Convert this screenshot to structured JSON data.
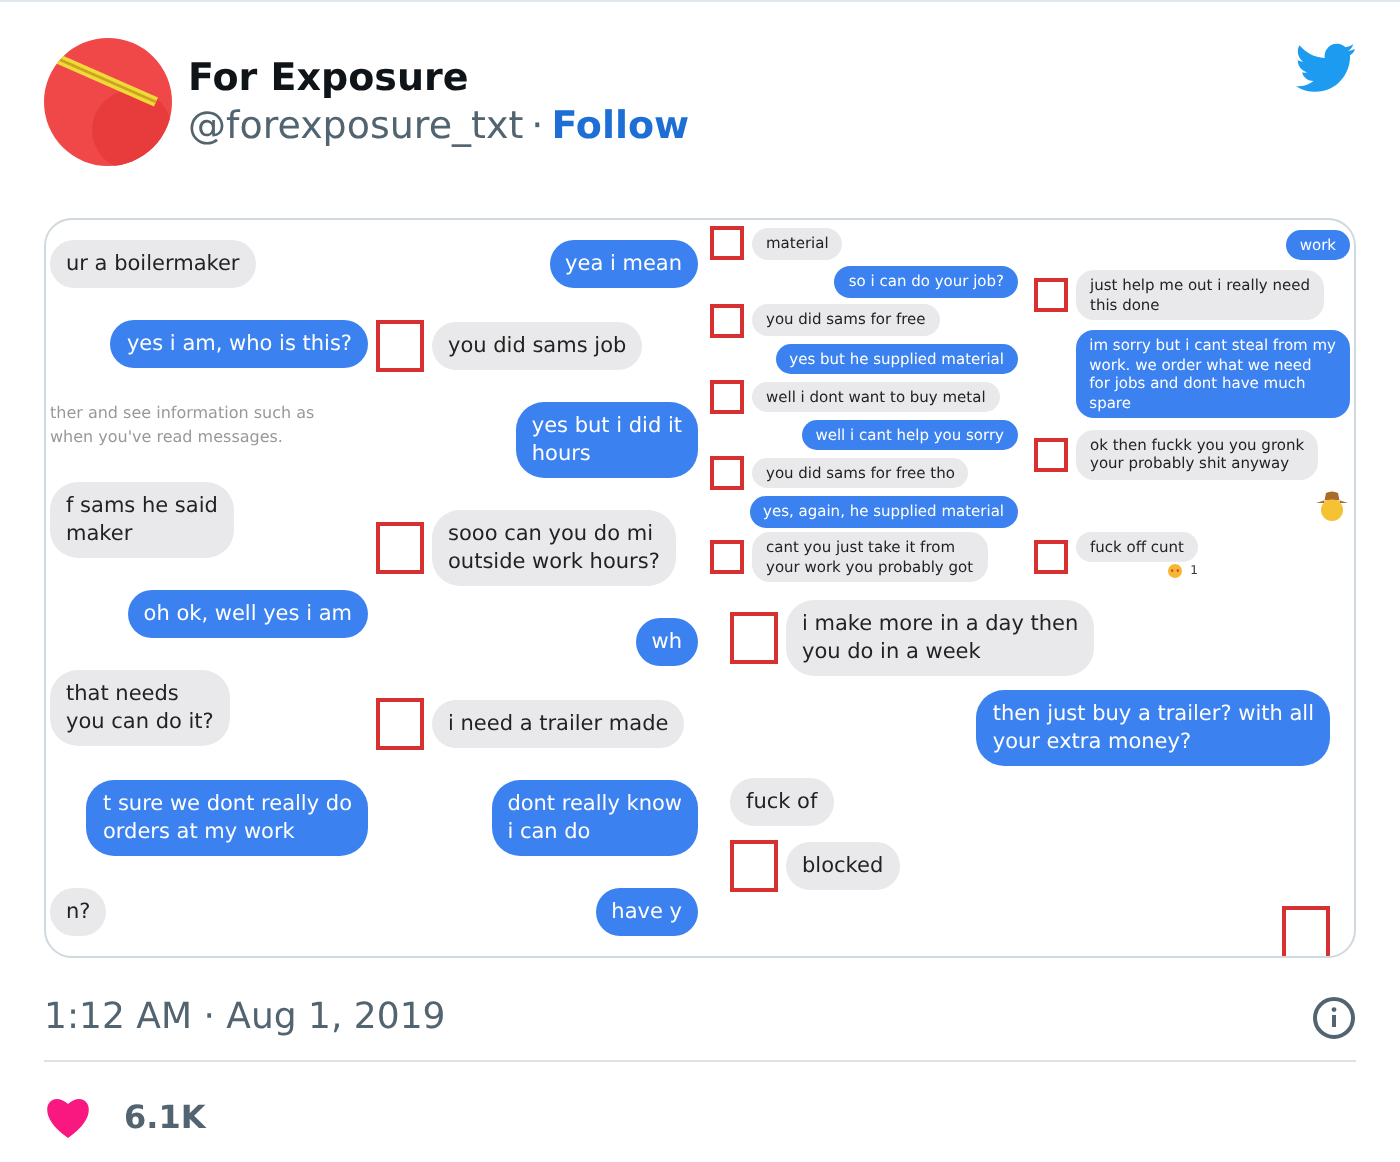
{
  "author": {
    "name": "For Exposure",
    "handle": "@forexposure_txt",
    "separator": "·",
    "follow": "Follow"
  },
  "media": {
    "panels": [
      {
        "messages": [
          {
            "kind": "received",
            "text": "ur a boilermaker",
            "boxed": false
          },
          {
            "kind": "sent",
            "text": "yes i am, who is this?",
            "boxed": false
          },
          {
            "kind": "notice",
            "text": "ther and see information such as\nwhen you've read messages.",
            "boxed": false
          },
          {
            "kind": "received",
            "text": "f sams he said\nmaker",
            "boxed": false
          },
          {
            "kind": "sent",
            "text": "oh ok, well yes i am",
            "boxed": false
          },
          {
            "kind": "received",
            "text": "that needs\nyou can do it?",
            "boxed": false
          },
          {
            "kind": "sent",
            "text": "t sure we dont really do\norders at my work",
            "boxed": false
          },
          {
            "kind": "received",
            "text": "n?",
            "boxed": false
          }
        ]
      },
      {
        "messages": [
          {
            "kind": "sent",
            "text": "yea i mean",
            "boxed": false
          },
          {
            "kind": "received",
            "text": "you did sams job",
            "boxed": true
          },
          {
            "kind": "sent",
            "text": "yes but i did it\nhours",
            "boxed": false
          },
          {
            "kind": "received",
            "text": "sooo can you do mi\noutside work hours?",
            "boxed": true
          },
          {
            "kind": "sent",
            "text": "wh",
            "boxed": false
          },
          {
            "kind": "received",
            "text": "i need a trailer made",
            "boxed": true
          },
          {
            "kind": "sent",
            "text": "dont really know\ni can do",
            "boxed": false
          },
          {
            "kind": "sent",
            "text": "have y",
            "boxed": false
          }
        ]
      },
      {
        "kind": "compact",
        "messages": [
          {
            "kind": "received",
            "text": "material",
            "boxed": true
          },
          {
            "kind": "sent",
            "text": "so i can do your job?",
            "boxed": false
          },
          {
            "kind": "received",
            "text": "you did sams for free",
            "boxed": true
          },
          {
            "kind": "sent",
            "text": "yes but he supplied material",
            "boxed": false
          },
          {
            "kind": "received",
            "text": "well i dont want to buy metal",
            "boxed": true
          },
          {
            "kind": "sent",
            "text": "well i cant help you sorry",
            "boxed": false
          },
          {
            "kind": "received",
            "text": "you did sams for free tho",
            "boxed": true
          },
          {
            "kind": "sent",
            "text": "yes, again, he supplied material",
            "boxed": false
          },
          {
            "kind": "received",
            "text": "cant you just take it from\nyour work you probably got",
            "boxed": true
          }
        ]
      },
      {
        "kind": "compact",
        "messages": [
          {
            "kind": "sent",
            "text": "work",
            "boxed": false
          },
          {
            "kind": "received",
            "text": "just help me out i really need\nthis done",
            "boxed": true
          },
          {
            "kind": "sent",
            "text": "im sorry but i cant steal from my\nwork. we order what we need\nfor jobs and dont have much\nspare",
            "boxed": false
          },
          {
            "kind": "received",
            "text": "ok then fuckk you you gronk\nyour probably shit anyway",
            "boxed": true
          },
          {
            "kind": "emoji"
          },
          {
            "kind": "received",
            "text": "fuck off cunt",
            "boxed": true,
            "reaction": "1"
          }
        ]
      },
      {
        "messages": [
          {
            "kind": "received",
            "text": "i make more in a day then\nyou do in a week",
            "boxed": true
          },
          {
            "kind": "sent",
            "text": "then just buy a trailer? with all\nyour extra money?",
            "boxed": false
          },
          {
            "kind": "received",
            "text": "fuck of",
            "boxed": false
          },
          {
            "kind": "received",
            "text": "blocked",
            "boxed": true
          },
          {
            "kind": "marker"
          }
        ]
      }
    ]
  },
  "timestamp": "1:12 AM · Aug 1, 2019",
  "likes": "6.1K"
}
